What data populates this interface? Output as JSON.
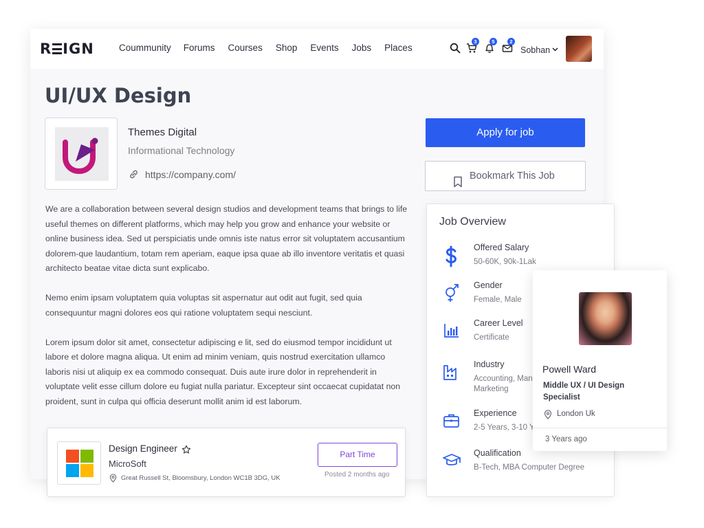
{
  "header": {
    "logo": "REIGN",
    "nav": [
      "Coummunity",
      "Forums",
      "Courses",
      "Shop",
      "Events",
      "Jobs",
      "Places"
    ],
    "icons": [
      "search-icon",
      "cart-icon",
      "bell-icon",
      "mail-icon"
    ],
    "badges": {
      "cart": "3",
      "notifications": "5",
      "messages": "2"
    },
    "user": {
      "name": "Sobhan"
    }
  },
  "job": {
    "title": "UI/UX Design",
    "company": "Themes Digital",
    "category": "Informational Technology",
    "url": "https://company.com/",
    "description": [
      "We are a collaboration between several design studios and development teams that brings to life useful themes on different platforms, which may help you grow and enhance your website or online business idea. Sed ut perspiciatis unde omnis iste natus error sit voluptatem accusantium dolorem-que laudantium, totam rem aperiam, eaque ipsa quae ab illo inventore veritatis et quasi architecto beatae vitae dicta sunt explicabo.",
      "Nemo enim ipsam voluptatem quia voluptas sit aspernatur aut odit aut fugit, sed quia consequuntur magni dolores eos qui ratione voluptatem sequi nesciunt.",
      "Lorem ipsum dolor sit amet, consectetur adipiscing e lit, sed do eiusmod tempor incididunt ut labore et dolore magna aliqua. Ut enim ad minim veniam, quis nostrud exercitation ullamco laboris nisi ut aliquip ex ea commodo consequat. Duis aute irure dolor in reprehenderit in voluptate velit esse cillum dolore eu fugiat nulla pariatur. Excepteur sint occaecat cupidatat non proident, sunt in culpa qui officia deserunt mollit anim id est laborum."
    ],
    "apply_label": "Apply for job",
    "bookmark_label": "Bookmark This Job"
  },
  "overview": {
    "title": "Job Overview",
    "items": [
      {
        "icon": "dollar-icon",
        "label": "Offered Salary",
        "value": "50-60K, 90k-1Lak"
      },
      {
        "icon": "gender-icon",
        "label": "Gender",
        "value": "Female, Male"
      },
      {
        "icon": "bar-chart-icon",
        "label": "Career Level",
        "value": "Certificate"
      },
      {
        "icon": "factory-icon",
        "label": "Industry",
        "value": "Accounting, Management\nMarketing"
      },
      {
        "icon": "briefcase-icon",
        "label": "Experience",
        "value": "2-5 Years, 3-10 Years"
      },
      {
        "icon": "graduation-cap-icon",
        "label": "Qualification",
        "value": "B-Tech, MBA Computer Degree"
      }
    ]
  },
  "profile": {
    "name": "Powell Ward",
    "role": "Middle UX / UI Design Specialist",
    "location": "London Uk",
    "time": "3 Years ago"
  },
  "job_card": {
    "title": "Design Engineer",
    "company": "MicroSoft",
    "address": "Great Russell St, Bloomsbury, London WC1B 3DG, UK",
    "type": "Part Time",
    "posted": "Posted 2 months ago"
  },
  "colors": {
    "accent": "#2a5cf0",
    "purple": "#7d46d6",
    "brand_magenta": "#c2187a"
  }
}
